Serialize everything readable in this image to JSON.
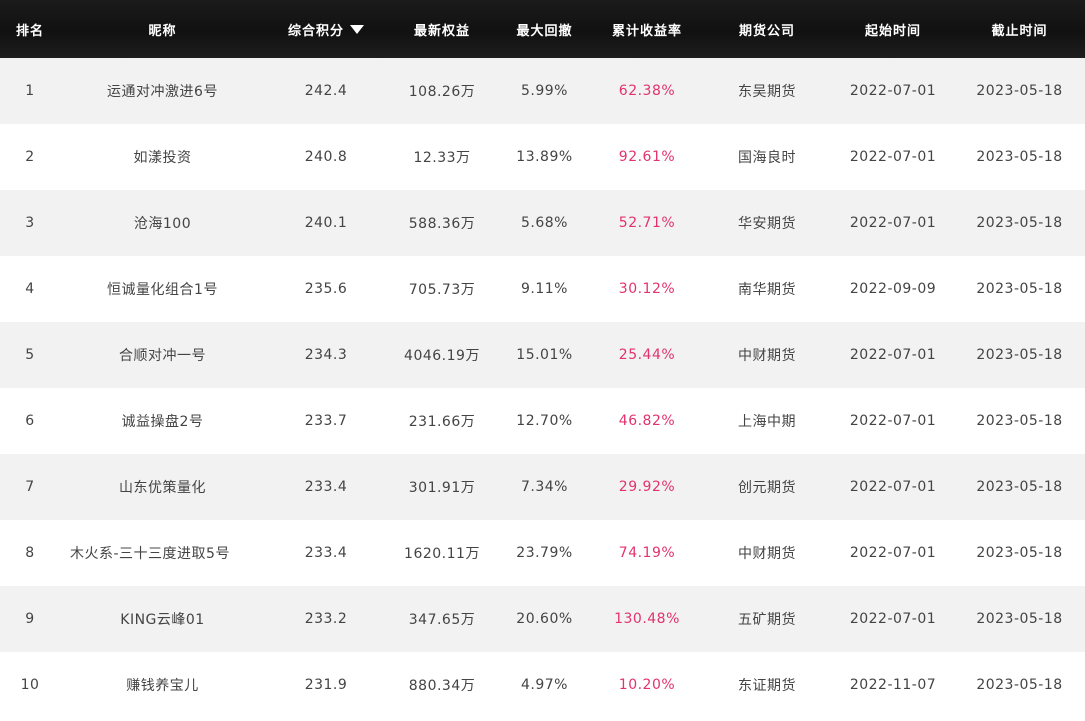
{
  "colors": {
    "header_bg": "#151515",
    "accent_return": "#e2336f",
    "row_alt": "#f2f2f2"
  },
  "header": {
    "rank": "排名",
    "name": "昵称",
    "score": "综合积分",
    "equity": "最新权益",
    "drawdown": "最大回撤",
    "return": "累计收益率",
    "broker": "期货公司",
    "start": "起始时间",
    "end": "截止时间",
    "sort_icon": "caret-down-icon"
  },
  "rows": [
    {
      "rank": "1",
      "name": "运通对冲激进6号",
      "score": "242.4",
      "equity": "108.26万",
      "drawdown": "5.99%",
      "return": "62.38%",
      "broker": "东吴期货",
      "start": "2022-07-01",
      "end": "2023-05-18"
    },
    {
      "rank": "2",
      "name": "如漾投资",
      "score": "240.8",
      "equity": "12.33万",
      "drawdown": "13.89%",
      "return": "92.61%",
      "broker": "国海良时",
      "start": "2022-07-01",
      "end": "2023-05-18"
    },
    {
      "rank": "3",
      "name": "沧海100",
      "score": "240.1",
      "equity": "588.36万",
      "drawdown": "5.68%",
      "return": "52.71%",
      "broker": "华安期货",
      "start": "2022-07-01",
      "end": "2023-05-18"
    },
    {
      "rank": "4",
      "name": "恒诚量化组合1号",
      "score": "235.6",
      "equity": "705.73万",
      "drawdown": "9.11%",
      "return": "30.12%",
      "broker": "南华期货",
      "start": "2022-09-09",
      "end": "2023-05-18"
    },
    {
      "rank": "5",
      "name": "合顺对冲一号",
      "score": "234.3",
      "equity": "4046.19万",
      "drawdown": "15.01%",
      "return": "25.44%",
      "broker": "中财期货",
      "start": "2022-07-01",
      "end": "2023-05-18"
    },
    {
      "rank": "6",
      "name": "诚益操盘2号",
      "score": "233.7",
      "equity": "231.66万",
      "drawdown": "12.70%",
      "return": "46.82%",
      "broker": "上海中期",
      "start": "2022-07-01",
      "end": "2023-05-18"
    },
    {
      "rank": "7",
      "name": "山东优策量化",
      "score": "233.4",
      "equity": "301.91万",
      "drawdown": "7.34%",
      "return": "29.92%",
      "broker": "创元期货",
      "start": "2022-07-01",
      "end": "2023-05-18"
    },
    {
      "rank": "8",
      "name": "木火系-三十三度进取5号",
      "score": "233.4",
      "equity": "1620.11万",
      "drawdown": "23.79%",
      "return": "74.19%",
      "broker": "中财期货",
      "start": "2022-07-01",
      "end": "2023-05-18"
    },
    {
      "rank": "9",
      "name": "KING云峰01",
      "score": "233.2",
      "equity": "347.65万",
      "drawdown": "20.60%",
      "return": "130.48%",
      "broker": "五矿期货",
      "start": "2022-07-01",
      "end": "2023-05-18"
    },
    {
      "rank": "10",
      "name": "赚钱养宝儿",
      "score": "231.9",
      "equity": "880.34万",
      "drawdown": "4.97%",
      "return": "10.20%",
      "broker": "东证期货",
      "start": "2022-11-07",
      "end": "2023-05-18"
    }
  ]
}
